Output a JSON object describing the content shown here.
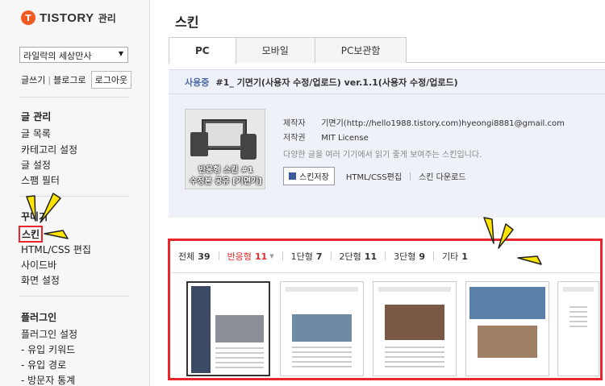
{
  "brand": {
    "logo_letter": "T",
    "name": "TISTORY",
    "suffix": "관리"
  },
  "sidebar": {
    "blog_select": "라일락의 세상만사",
    "quick_links": [
      "글쓰기",
      "블로그로"
    ],
    "logout_label": "로그아웃",
    "sections": [
      {
        "title": "글 관리",
        "items": [
          "글 목록",
          "카테고리 설정",
          "글 설정",
          "스팸 필터"
        ]
      },
      {
        "title": "꾸미기",
        "items": [
          "스킨",
          "HTML/CSS 편집",
          "사이드바",
          "화면 설정"
        ]
      },
      {
        "title": "플러그인",
        "items": [
          "플러그인 설정",
          "- 유입 키워드",
          "- 유입 경로",
          "- 방문자 통계"
        ]
      }
    ]
  },
  "main": {
    "title": "스킨",
    "tabs": [
      "PC",
      "모바일",
      "PC보관함"
    ],
    "active_tab": "PC",
    "current": {
      "label": "사용중",
      "name": "#1_ 기면기(사용자 수정/업로드) ver.1.1(사용자 수정/업로드)",
      "thumb_caption_1": "반응형 스킨 #1",
      "thumb_caption_2": "수정본 공유 [기면기]",
      "maker_label": "제작자",
      "maker_value": "기면기(http://hello1988.tistory.com)hyeongi8881@gmail.com",
      "license_label": "저작권",
      "license_value": "MIT License",
      "description": "다양한 글을 여러 기기에서 읽기 좋게 보여주는 스킨입니다.",
      "save_label": "스킨저장",
      "edit_label": "HTML/CSS편집",
      "download_label": "스킨 다운로드"
    },
    "filters": [
      {
        "label": "전체",
        "count": "39"
      },
      {
        "label": "반응형",
        "count": "11"
      },
      {
        "label": "1단형",
        "count": "7"
      },
      {
        "label": "2단형",
        "count": "11"
      },
      {
        "label": "3단형",
        "count": "9"
      },
      {
        "label": "기타",
        "count": "1"
      }
    ],
    "active_filter": "반응형"
  },
  "colors": {
    "accent": "#e8262b",
    "brand": "#f15a22",
    "pointer": "#ffe400"
  }
}
